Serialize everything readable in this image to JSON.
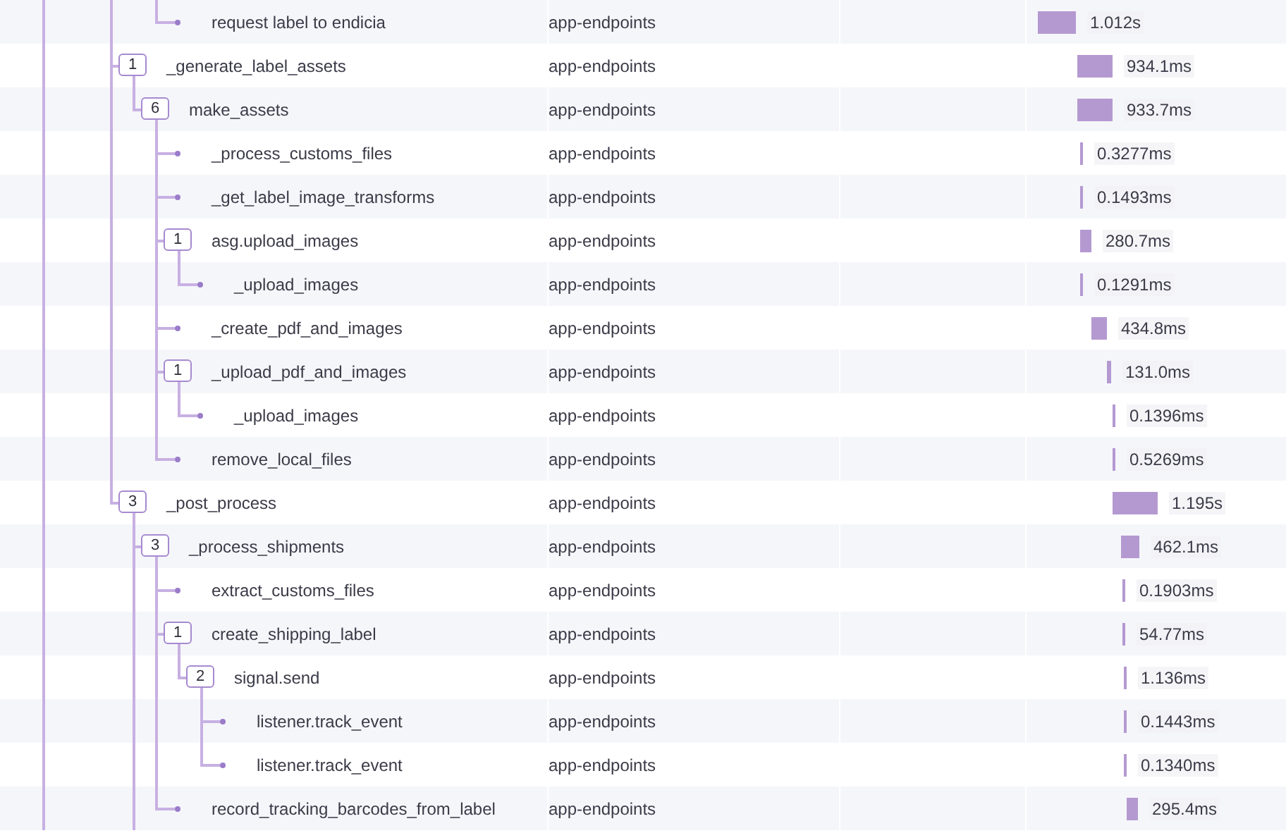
{
  "spans": [
    {
      "children": [
        {
          "children": [
            {
              "name": "request label to endicia",
              "service": "app-endpoints",
              "duration": "1.012s"
            }
          ]
        }
      ]
    },
    {
      "name": "_generate_label_assets",
      "count": "1",
      "service": "app-endpoints",
      "duration": "934.1ms",
      "children": [
        {
          "name": "make_assets",
          "count": "6",
          "service": "app-endpoints",
          "duration": "933.7ms",
          "children": [
            {
              "name": "_process_customs_files",
              "service": "app-endpoints",
              "duration": "0.3277ms"
            },
            {
              "name": "_get_label_image_transforms",
              "service": "app-endpoints",
              "duration": "0.1493ms"
            },
            {
              "name": "asg.upload_images",
              "count": "1",
              "service": "app-endpoints",
              "duration": "280.7ms",
              "children": [
                {
                  "name": "_upload_images",
                  "service": "app-endpoints",
                  "duration": "0.1291ms"
                }
              ]
            },
            {
              "name": "_create_pdf_and_images",
              "service": "app-endpoints",
              "duration": "434.8ms"
            },
            {
              "name": "_upload_pdf_and_images",
              "count": "1",
              "service": "app-endpoints",
              "duration": "131.0ms",
              "children": [
                {
                  "name": "_upload_images",
                  "service": "app-endpoints",
                  "duration": "0.1396ms"
                }
              ]
            },
            {
              "name": "remove_local_files",
              "service": "app-endpoints",
              "duration": "0.5269ms"
            }
          ]
        }
      ]
    },
    {
      "name": "_post_process",
      "count": "3",
      "more_children": true,
      "service": "app-endpoints",
      "duration": "1.195s",
      "children": [
        {
          "name": "_process_shipments",
          "count": "3",
          "service": "app-endpoints",
          "duration": "462.1ms",
          "children": [
            {
              "name": "extract_customs_files",
              "service": "app-endpoints",
              "duration": "0.1903ms"
            },
            {
              "name": "create_shipping_label",
              "count": "1",
              "service": "app-endpoints",
              "duration": "54.77ms",
              "children": [
                {
                  "name": "signal.send",
                  "count": "2",
                  "service": "app-endpoints",
                  "duration": "1.136ms",
                  "children": [
                    {
                      "name": "listener.track_event",
                      "service": "app-endpoints",
                      "duration": "0.1443ms"
                    },
                    {
                      "name": "listener.track_event",
                      "service": "app-endpoints",
                      "duration": "0.1340ms"
                    }
                  ]
                }
              ]
            },
            {
              "name": "record_tracking_barcodes_from_label",
              "service": "app-endpoints",
              "duration": "295.4ms"
            }
          ]
        }
      ]
    }
  ]
}
